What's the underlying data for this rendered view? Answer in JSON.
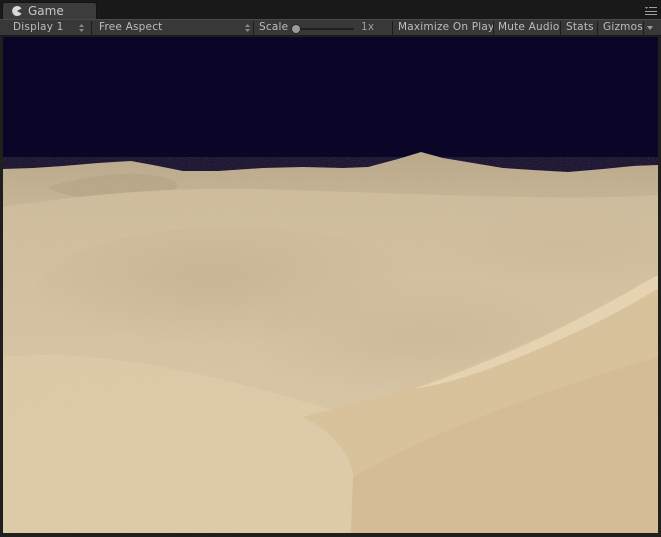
{
  "window": {
    "tab": {
      "title": "Game",
      "icon": "pacman-icon"
    }
  },
  "toolbar": {
    "display": "Display 1",
    "aspect": "Free Aspect",
    "scale_label": "Scale",
    "scale_value_label": "1x",
    "scale_level": 0.0,
    "maximize_on_play": "Maximize On Play",
    "mute_audio": "Mute Audio",
    "stats": "Stats",
    "gizmos": "Gizmos"
  },
  "viewport": {
    "sky_color": "#0b0528",
    "sand_color": "#d6c3a0",
    "scene": "desert sand dunes"
  }
}
